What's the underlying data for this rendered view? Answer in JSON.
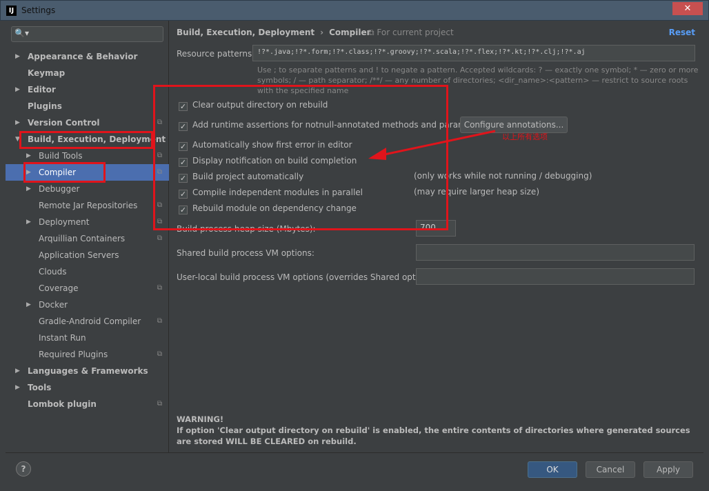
{
  "window": {
    "title": "Settings",
    "close": "✕",
    "app_icon": "IJ"
  },
  "search": {
    "icon": "🔍▾",
    "placeholder": ""
  },
  "tree": [
    {
      "label": "Appearance & Behavior",
      "level": 0,
      "arrow": "▶",
      "proj": false
    },
    {
      "label": "Keymap",
      "level": 0,
      "arrow": "",
      "proj": false
    },
    {
      "label": "Editor",
      "level": 0,
      "arrow": "▶",
      "proj": false
    },
    {
      "label": "Plugins",
      "level": 0,
      "arrow": "",
      "proj": false
    },
    {
      "label": "Version Control",
      "level": 0,
      "arrow": "▶",
      "proj": true
    },
    {
      "label": "Build, Execution, Deployment",
      "level": 0,
      "arrow": "▼",
      "proj": false
    },
    {
      "label": "Build Tools",
      "level": 1,
      "arrow": "▶",
      "proj": true
    },
    {
      "label": "Compiler",
      "level": 1,
      "arrow": "▶",
      "proj": true,
      "selected": true
    },
    {
      "label": "Debugger",
      "level": 1,
      "arrow": "▶",
      "proj": false
    },
    {
      "label": "Remote Jar Repositories",
      "level": 1,
      "arrow": "",
      "proj": true
    },
    {
      "label": "Deployment",
      "level": 1,
      "arrow": "▶",
      "proj": true
    },
    {
      "label": "Arquillian Containers",
      "level": 1,
      "arrow": "",
      "proj": true
    },
    {
      "label": "Application Servers",
      "level": 1,
      "arrow": "",
      "proj": false
    },
    {
      "label": "Clouds",
      "level": 1,
      "arrow": "",
      "proj": false
    },
    {
      "label": "Coverage",
      "level": 1,
      "arrow": "",
      "proj": true
    },
    {
      "label": "Docker",
      "level": 1,
      "arrow": "▶",
      "proj": false
    },
    {
      "label": "Gradle-Android Compiler",
      "level": 1,
      "arrow": "",
      "proj": true
    },
    {
      "label": "Instant Run",
      "level": 1,
      "arrow": "",
      "proj": false
    },
    {
      "label": "Required Plugins",
      "level": 1,
      "arrow": "",
      "proj": true
    },
    {
      "label": "Languages & Frameworks",
      "level": 0,
      "arrow": "▶",
      "proj": false
    },
    {
      "label": "Tools",
      "level": 0,
      "arrow": "▶",
      "proj": false
    },
    {
      "label": "Lombok plugin",
      "level": 0,
      "arrow": "",
      "proj": true
    }
  ],
  "breadcrumb": {
    "parent": "Build, Execution, Deployment",
    "sep": "›",
    "current": "Compiler",
    "scope": "⧉ For current project",
    "reset": "Reset"
  },
  "resource": {
    "label": "Resource patterns:",
    "value": "!?*.java;!?*.form;!?*.class;!?*.groovy;!?*.scala;!?*.flex;!?*.kt;!?*.clj;!?*.aj",
    "hint": "Use ; to separate patterns and ! to negate a pattern. Accepted wildcards: ? — exactly one symbol; * — zero or more symbols; / — path separator; /**/ — any number of directories; <dir_name>:<pattern> — restrict to source roots with the specified name"
  },
  "checkboxes": [
    {
      "label": "Clear output directory on rebuild",
      "checked": true,
      "note": ""
    },
    {
      "label": "Add runtime assertions for notnull-annotated methods and parameters",
      "checked": true,
      "note": ""
    },
    {
      "label": "Automatically show first error in editor",
      "checked": true,
      "note": ""
    },
    {
      "label": "Display notification on build completion",
      "checked": true,
      "note": ""
    },
    {
      "label": "Build project automatically",
      "checked": true,
      "note": "(only works while not running / debugging)"
    },
    {
      "label": "Compile independent modules in parallel",
      "checked": true,
      "note": "(may require larger heap size)"
    },
    {
      "label": "Rebuild module on dependency change",
      "checked": true,
      "note": ""
    }
  ],
  "configure_btn": "Configure annotations...",
  "heap": {
    "label": "Build process heap size (Mbytes):",
    "value": "700"
  },
  "shared_vm": {
    "label": "Shared build process VM options:",
    "value": ""
  },
  "user_vm": {
    "label": "User-local build process VM options (overrides Shared options):",
    "value": ""
  },
  "warning": {
    "title": "WARNING!",
    "text": "If option 'Clear output directory on rebuild' is enabled, the entire contents of directories where generated sources are stored WILL BE CLEARED on rebuild."
  },
  "annotation": "以上所有选项",
  "buttons": {
    "help": "?",
    "ok": "OK",
    "cancel": "Cancel",
    "apply": "Apply"
  },
  "colors": {
    "accent": "#4b6eaf",
    "annotation": "#e0141b",
    "link": "#589df6"
  }
}
